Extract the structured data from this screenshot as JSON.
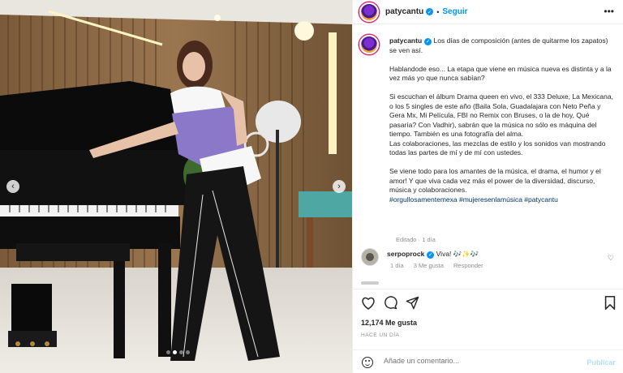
{
  "post": {
    "nav": {
      "prev_icon": "chevron-left-icon",
      "next_icon": "chevron-right-icon",
      "prev_glyph": "‹",
      "next_glyph": "›"
    }
  },
  "header": {
    "username": "patycantu",
    "separator": "•",
    "follow_label": "Seguir",
    "more_glyph": "•••"
  },
  "caption": {
    "username": "patycantu",
    "text": " Los días de composición (antes de quitarme los zapatos) se ven así.\n\nHablandode eso... La etapa que viene en música nueva es distinta y a la vez más yo que nunca sabían?\n\nSi escuchan el álbum Drama queen en vivo, el 333 Deluxe, La Mexicana, o los 5 singles de este año (Baila Sola, Guadalajara con Neto Peña y Gera Mx, Mi Película, FBI no Remix con Bruses, o la de hoy, Qué pasaría? Con Vadhir), sabrán que la música no sólo es máquina del tiempo. También es una fotografía del alma.\nLas colaboraciones, las mezclas de estilo y los sonidos van mostrando todas las partes de mí y de mí con ustedes.\n\nSe viene todo para los amantes de la música, el drama, el humor y el amor! Y que viva cada vez más el power de la diversidad, discurso, música y colaboraciones.\n",
    "hashtags": "#orgullosamentemexa #mujeresenlamúsica #patycantu",
    "meta": "Editado · 1 día"
  },
  "comment": {
    "username": "serpoprock",
    "text": " Viva! 🎶✨🎶",
    "time": "1 día",
    "likes": "3 Me gusta",
    "reply": "Responder",
    "heart_glyph": "♡"
  },
  "actions": {
    "likes": "12,174 Me gusta",
    "time": "HACE UN DÍA",
    "comment_placeholder": "Añade un comentario...",
    "publish_label": "Publicar"
  },
  "colors": {
    "accent": "#0095f6",
    "text": "#262626",
    "muted": "#8e8e8e",
    "purple_top": "#8b78c9"
  }
}
